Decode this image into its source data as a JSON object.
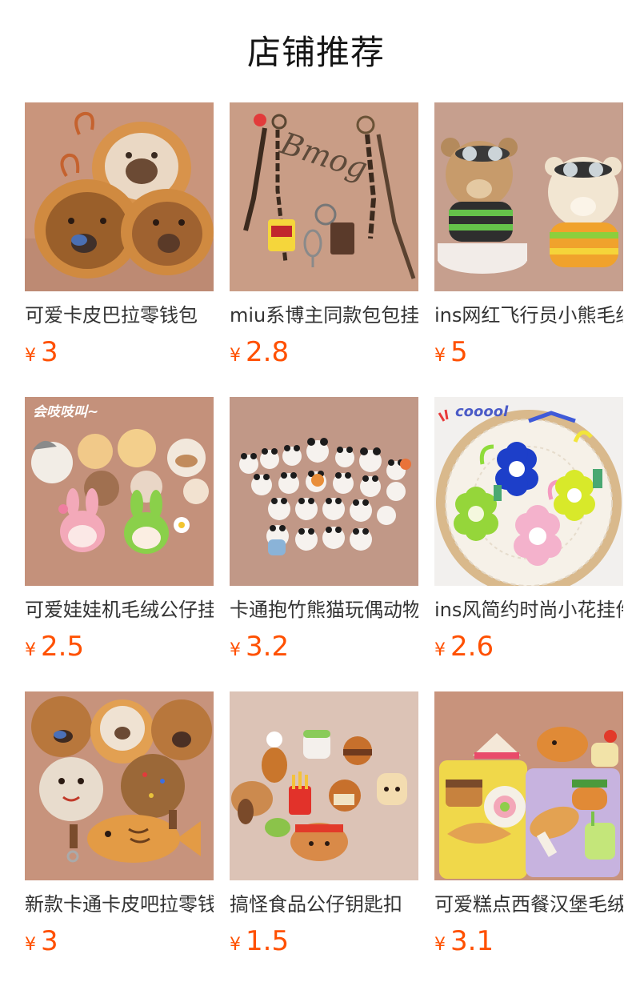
{
  "header": {
    "title": "店铺推荐"
  },
  "colors": {
    "price": "#ff5000",
    "thumb_bg_warm": "#c99a82",
    "thumb_bg_light": "#eeeeee"
  },
  "products": [
    {
      "name": "可爱卡皮巴拉零钱包",
      "currency": "¥",
      "price": "3"
    },
    {
      "name": "miu系博主同款包包挂件",
      "currency": "¥",
      "price": "2.8"
    },
    {
      "name": "ins网红飞行员小熊毛绒",
      "currency": "¥",
      "price": "5"
    },
    {
      "name": "可爱娃娃机毛绒公仔挂件",
      "currency": "¥",
      "price": "2.5",
      "image_caption": "会吱吱叫~"
    },
    {
      "name": "卡通抱竹熊猫玩偶动物",
      "currency": "¥",
      "price": "3.2"
    },
    {
      "name": "ins风简约时尚小花挂件",
      "currency": "¥",
      "price": "2.6",
      "image_caption": "cooool"
    },
    {
      "name": "新款卡通卡皮吧拉零钱包",
      "currency": "¥",
      "price": "3"
    },
    {
      "name": "搞怪食品公仔钥匙扣",
      "currency": "¥",
      "price": "1.5"
    },
    {
      "name": "可爱糕点西餐汉堡毛绒",
      "currency": "¥",
      "price": "3.1"
    }
  ]
}
